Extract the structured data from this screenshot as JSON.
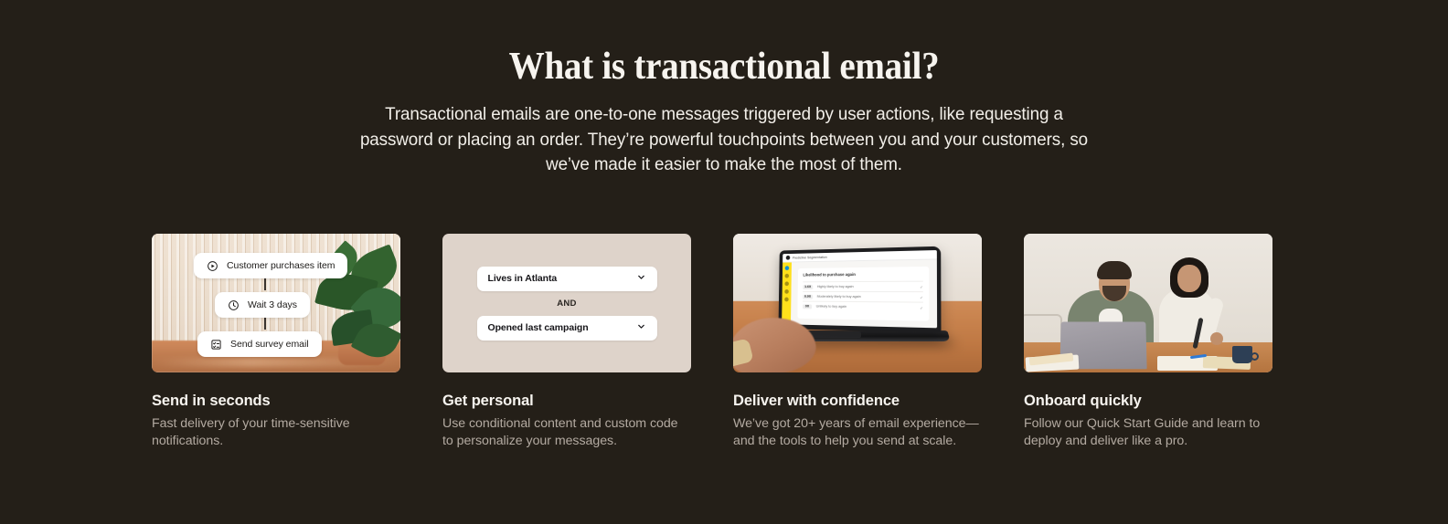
{
  "section": {
    "headline": "What is transactional email?",
    "subhead": "Transactional emails are one-to-one messages triggered by user actions, like requesting a password or placing an order. They’re powerful touchpoints between you and your customers, so we’ve made it easier to make the most of them."
  },
  "theme": {
    "background": "#241f18",
    "headline_color": "#f7f4ef",
    "body_color": "#f2efe9",
    "muted_color": "#b3aaa1",
    "card2_background": "#ded3ca",
    "accent_yellow": "#ffe01b"
  },
  "cards": [
    {
      "title": "Send in seconds",
      "description": "Fast delivery of your time-sensitive notifications.",
      "media": {
        "kind": "automation-flow",
        "steps": [
          {
            "label": "Customer purchases item",
            "icon": "play-circle-icon"
          },
          {
            "label": "Wait 3 days",
            "icon": "clock-icon"
          },
          {
            "label": "Send survey email",
            "icon": "checklist-icon"
          }
        ]
      }
    },
    {
      "title": "Get personal",
      "description": "Use conditional content and custom code to personalize your messages.",
      "media": {
        "kind": "conditions",
        "conditions": [
          {
            "label": "Lives in Atlanta",
            "icon": "chevron-down-icon"
          },
          {
            "label": "Opened last campaign",
            "icon": "chevron-down-icon"
          }
        ],
        "operator": "AND"
      }
    },
    {
      "title": "Deliver with confidence",
      "description": "We’ve got 20+ years of email experience—and the tools to help you send at scale.",
      "media": {
        "kind": "laptop-photo",
        "screen": {
          "app_title": "Predictive Segmentation",
          "card_title": "Likelihood to purchase again",
          "rows": [
            {
              "value": "1.6X",
              "label": "Highly likely to buy again"
            },
            {
              "value": "0.9X",
              "label": "Moderately likely to buy again"
            },
            {
              "value": "0X",
              "label": "Unlikely to buy again"
            }
          ]
        }
      }
    },
    {
      "title": "Onboard quickly",
      "description": "Follow our Quick Start Guide and learn to deploy and deliver like a pro.",
      "media": {
        "kind": "team-photo"
      }
    }
  ]
}
